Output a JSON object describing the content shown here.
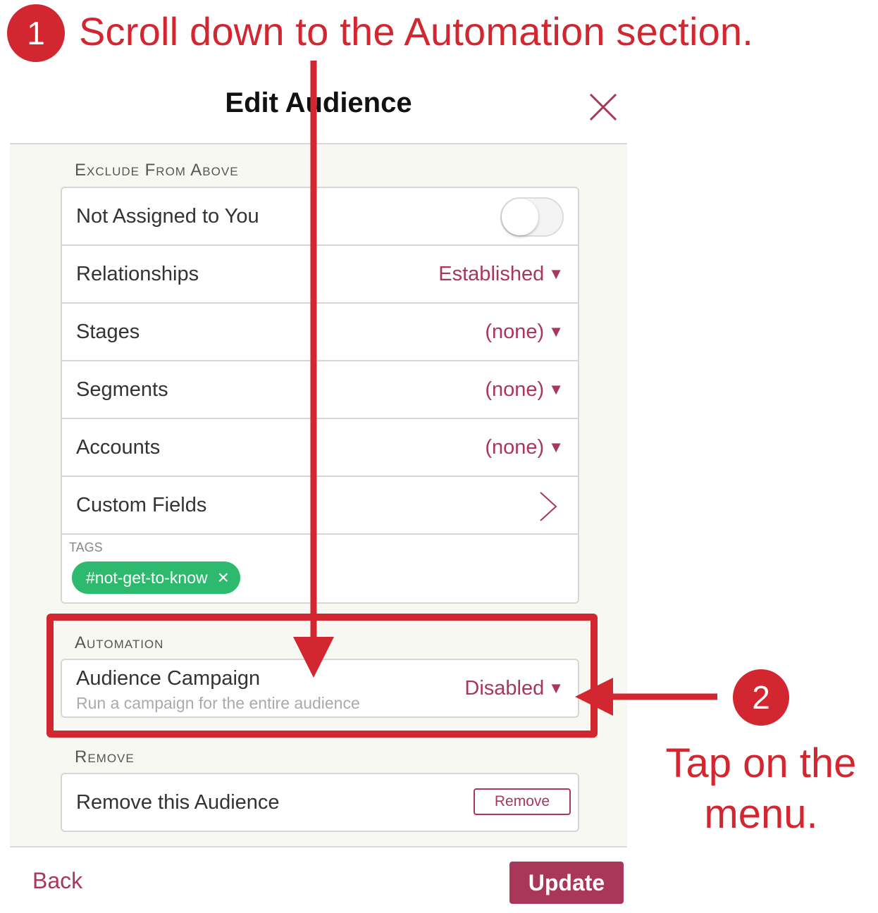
{
  "annotations": {
    "step1_number": "1",
    "step1_text": "Scroll down to the Automation section.",
    "step2_number": "2",
    "step2_text": "Tap on the menu."
  },
  "modal": {
    "title": "Edit Audience"
  },
  "exclude_section": {
    "label": "Exclude From Above",
    "rows": [
      {
        "label": "Not Assigned to You",
        "control": "toggle",
        "toggle_on": false
      },
      {
        "label": "Relationships",
        "value": "Established"
      },
      {
        "label": "Stages",
        "value": "(none)"
      },
      {
        "label": "Segments",
        "value": "(none)"
      },
      {
        "label": "Accounts",
        "value": "(none)"
      },
      {
        "label": "Custom Fields",
        "control": "chevron-right-icon"
      }
    ],
    "tags_label": "TAGS",
    "tags": [
      {
        "label": "#not-get-to-know",
        "remove_icon": "close-icon"
      }
    ]
  },
  "automation_section": {
    "label": "Automation",
    "campaign": {
      "title": "Audience Campaign",
      "subtitle": "Run a campaign for the entire audience",
      "value": "Disabled"
    }
  },
  "remove_section": {
    "label": "Remove",
    "row_label": "Remove this Audience",
    "button_label": "Remove"
  },
  "footer": {
    "back_label": "Back",
    "update_label": "Update"
  },
  "colors": {
    "accent": "#a8375a",
    "annotation_red": "#d22630",
    "tag_green": "#2dba6f",
    "panel_bg": "#f8f8f3"
  }
}
